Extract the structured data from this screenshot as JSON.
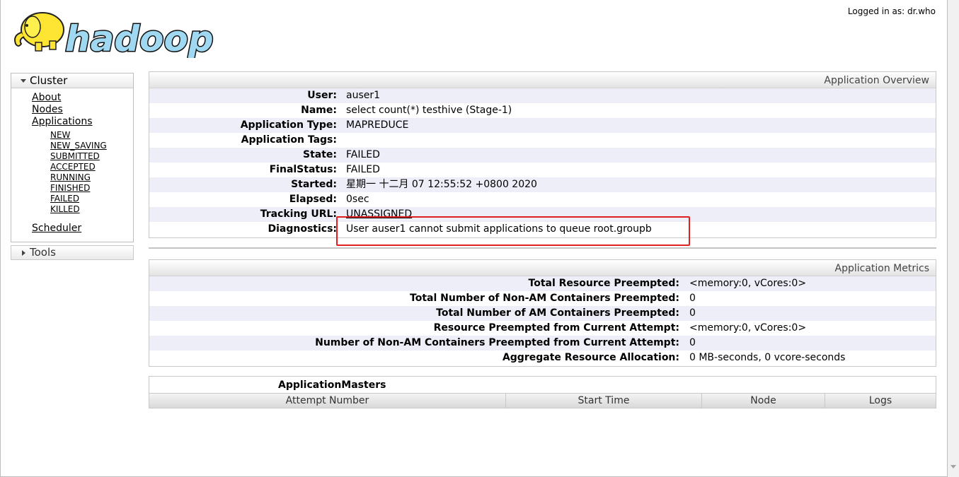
{
  "header": {
    "logo_text": "hadoop",
    "logged_in": "Logged in as: dr.who"
  },
  "sidebar": {
    "cluster": {
      "title": "Cluster",
      "links": [
        "About",
        "Nodes",
        "Applications"
      ],
      "app_states": [
        "NEW",
        "NEW_SAVING",
        "SUBMITTED",
        "ACCEPTED",
        "RUNNING",
        "FINISHED",
        "FAILED",
        "KILLED"
      ],
      "scheduler": "Scheduler"
    },
    "tools": {
      "title": "Tools"
    }
  },
  "overview": {
    "title": "Application Overview",
    "rows": [
      {
        "label": "User:",
        "value": "auser1"
      },
      {
        "label": "Name:",
        "value": "select count(*) testhive (Stage-1)"
      },
      {
        "label": "Application Type:",
        "value": "MAPREDUCE"
      },
      {
        "label": "Application Tags:",
        "value": ""
      },
      {
        "label": "State:",
        "value": "FAILED"
      },
      {
        "label": "FinalStatus:",
        "value": "FAILED"
      },
      {
        "label": "Started:",
        "value": "星期一 十二月 07 12:55:52 +0800 2020"
      },
      {
        "label": "Elapsed:",
        "value": "0sec"
      },
      {
        "label": "Tracking URL:",
        "value": "UNASSIGNED"
      },
      {
        "label": "Diagnostics:",
        "value": "User auser1 cannot submit applications to queue root.groupb"
      }
    ]
  },
  "metrics": {
    "title": "Application Metrics",
    "rows": [
      {
        "label": "Total Resource Preempted:",
        "value": "<memory:0, vCores:0>"
      },
      {
        "label": "Total Number of Non-AM Containers Preempted:",
        "value": "0"
      },
      {
        "label": "Total Number of AM Containers Preempted:",
        "value": "0"
      },
      {
        "label": "Resource Preempted from Current Attempt:",
        "value": "<memory:0, vCores:0>"
      },
      {
        "label": "Number of Non-AM Containers Preempted from Current Attempt:",
        "value": "0"
      },
      {
        "label": "Aggregate Resource Allocation:",
        "value": "0 MB-seconds, 0 vcore-seconds"
      }
    ]
  },
  "masters": {
    "caption": "ApplicationMasters",
    "columns": [
      "Attempt Number",
      "Start Time",
      "Node",
      "Logs"
    ]
  },
  "colors": {
    "highlight": "#e02020",
    "logo_blue": "#9fd8f0",
    "logo_yellow": "#ffe533"
  }
}
